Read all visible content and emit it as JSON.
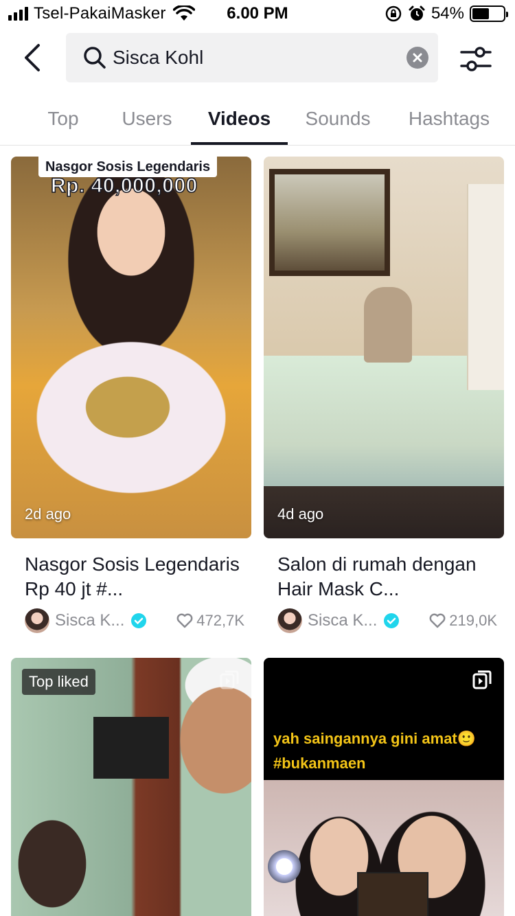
{
  "status_bar": {
    "carrier": "Tsel-PakaiMasker",
    "time": "6.00 PM",
    "battery": "54%",
    "battery_level": 0.54
  },
  "search": {
    "query": "Sisca Kohl"
  },
  "tabs": [
    {
      "label": "Top"
    },
    {
      "label": "Users"
    },
    {
      "label": "Videos"
    },
    {
      "label": "Sounds"
    },
    {
      "label": "Hashtags"
    }
  ],
  "active_tab": "Videos",
  "videos": [
    {
      "overlay_title": "Nasgor Sosis Legendaris",
      "overlay_price": "Rp. 40,000,000",
      "ago": "2d ago",
      "title": "Nasgor Sosis Legendaris Rp 40 jt #...",
      "author": "Sisca K...",
      "likes": "472,7K"
    },
    {
      "ago": "4d ago",
      "title": "Salon di rumah dengan Hair Mask C...",
      "author": "Sisca K...",
      "likes": "219,0K"
    },
    {
      "badge": "Top liked"
    },
    {
      "caption_line1": "yah saingannya gini amat🙂",
      "caption_line2": "#bukanmaen"
    }
  ]
}
